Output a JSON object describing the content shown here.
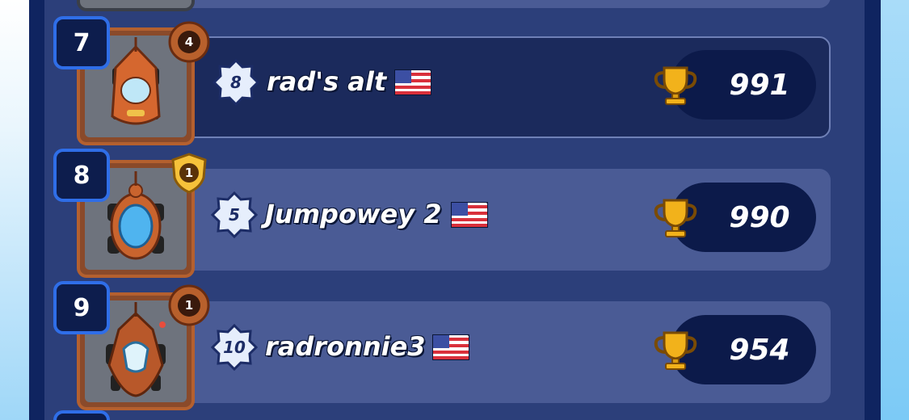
{
  "leaderboard": {
    "rows": [
      {
        "rank": "7",
        "badge": "4",
        "badge_type": "bronze-ring",
        "level": "8",
        "name": "rad's alt",
        "country_flag": "us-flag-icon",
        "score": "991",
        "highlighted": true,
        "car_color": "#d5672f"
      },
      {
        "rank": "8",
        "badge": "1",
        "badge_type": "gold-shield",
        "level": "5",
        "name": "Jumpowey 2",
        "country_flag": "us-flag-icon",
        "score": "990",
        "highlighted": false,
        "car_color": "#c9642e"
      },
      {
        "rank": "9",
        "badge": "1",
        "badge_type": "bronze-ring",
        "level": "10",
        "name": "radronnie3",
        "country_flag": "us-flag-icon",
        "score": "954",
        "highlighted": false,
        "car_color": "#b8582a"
      }
    ]
  },
  "colors": {
    "panel": "#2c3f7a",
    "row": "#4a5b95",
    "row_highlight": "#1b2a5c",
    "score_pill": "#0c1a4a",
    "rank_border": "#2f6ee8",
    "trophy": "#f2b21b"
  }
}
